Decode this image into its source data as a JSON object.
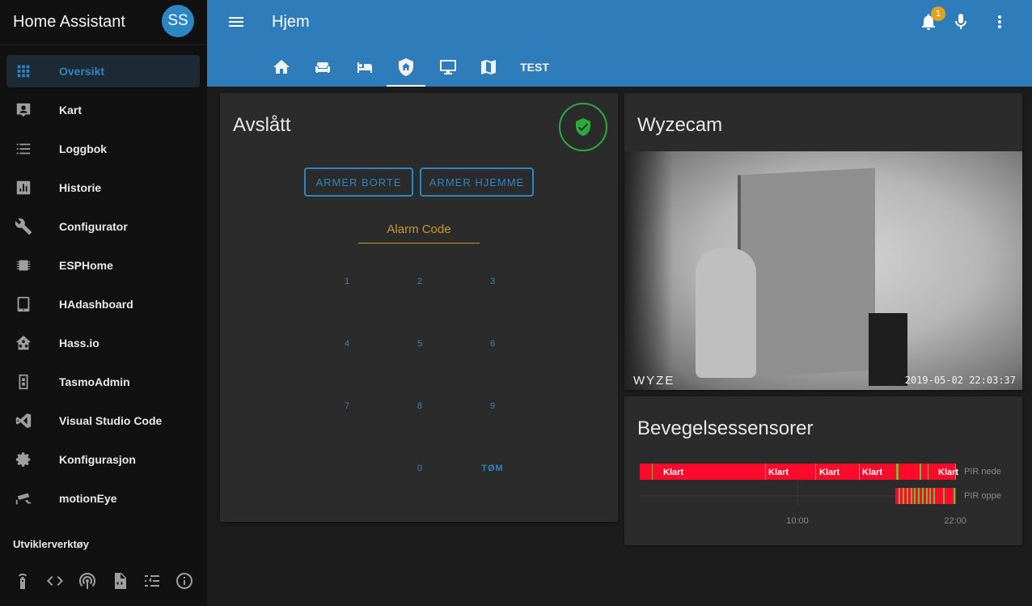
{
  "app": {
    "title": "Home Assistant",
    "avatar_initials": "SS"
  },
  "sidebar": {
    "items": [
      {
        "label": "Oversikt",
        "icon": "grid-icon",
        "active": true
      },
      {
        "label": "Kart",
        "icon": "account-box-icon"
      },
      {
        "label": "Loggbok",
        "icon": "list-icon"
      },
      {
        "label": "Historie",
        "icon": "poll-box-icon"
      },
      {
        "label": "Configurator",
        "icon": "wrench-icon"
      },
      {
        "label": "ESPHome",
        "icon": "chip-icon"
      },
      {
        "label": "HAdashboard",
        "icon": "tablet-icon"
      },
      {
        "label": "Hass.io",
        "icon": "home-assistant-icon"
      },
      {
        "label": "TasmoAdmin",
        "icon": "power-socket-icon"
      },
      {
        "label": "Visual Studio Code",
        "icon": "vscode-icon"
      },
      {
        "label": "Konfigurasjon",
        "icon": "gear-icon"
      },
      {
        "label": "motionEye",
        "icon": "cctv-icon"
      }
    ],
    "section_title": "Utviklerverktøy",
    "dev_tools": [
      "remote-icon",
      "code-icon",
      "broadcast-icon",
      "file-code-icon",
      "template-icon",
      "info-icon"
    ]
  },
  "header": {
    "view_title": "Hjem",
    "notification_count": "1",
    "tabs": [
      {
        "icon": "home-icon"
      },
      {
        "icon": "sofa-icon"
      },
      {
        "icon": "bed-icon"
      },
      {
        "icon": "shield-home-icon",
        "active": true
      },
      {
        "icon": "monitor-icon"
      },
      {
        "icon": "map-icon"
      },
      {
        "label": "TEST"
      }
    ]
  },
  "alarm_panel": {
    "state": "Avslått",
    "arm_away": "ARMER BORTE",
    "arm_home": "ARMER HJEMME",
    "code_placeholder": "Alarm Code",
    "keys": [
      "1",
      "2",
      "3",
      "4",
      "5",
      "6",
      "7",
      "8",
      "9",
      "0",
      "TØM"
    ]
  },
  "camera": {
    "title": "Wyzecam",
    "logo": "WYZE",
    "timestamp": "2019-05-02  22:03:37"
  },
  "motion": {
    "title": "Bevegelsessensorer"
  },
  "chart_data": {
    "type": "timeline",
    "title": "Bevegelsessensorer",
    "x_ticks": [
      "10:00",
      "22:00"
    ],
    "series": [
      {
        "name": "PIR nede",
        "labels": [
          "Klart",
          "Klart",
          "Klart",
          "Klart",
          "Klart"
        ]
      },
      {
        "name": "PIR oppe",
        "labels": []
      }
    ],
    "colors": {
      "clear": "#ff0a2b",
      "detected": "#7cb53b"
    }
  }
}
